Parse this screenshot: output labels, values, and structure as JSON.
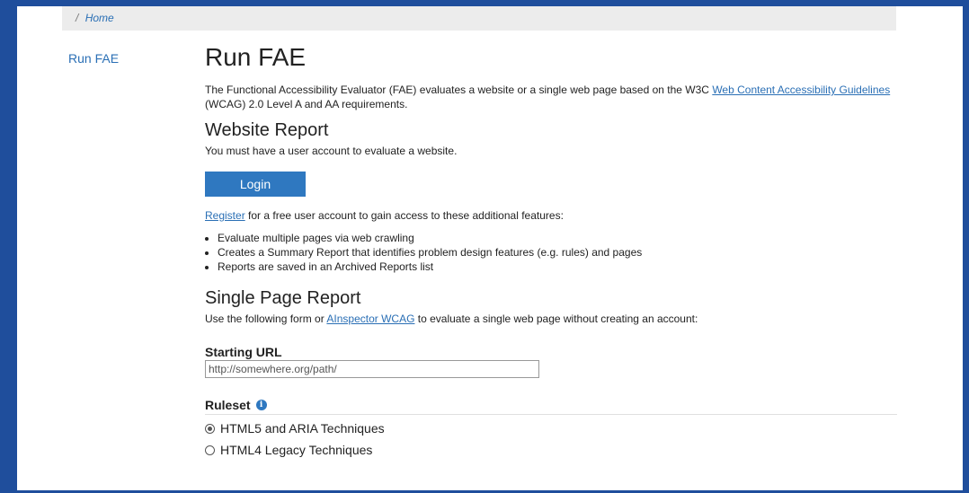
{
  "breadcrumb": {
    "separator": "/",
    "home": "Home"
  },
  "sidenav": {
    "item": "Run FAE"
  },
  "page": {
    "title": "Run FAE",
    "intro_before": "The Functional Accessibility Evaluator (FAE) evaluates a website or a single web page based on the W3C ",
    "intro_link": "Web Content Accessibility Guidelines",
    "intro_after": " (WCAG) 2.0 Level A and AA requirements."
  },
  "website_report": {
    "heading": "Website Report",
    "note": "You must have a user account to evaluate a website.",
    "login_label": "Login",
    "register_link": "Register",
    "register_text": " for a free user account to gain access to these additional features:",
    "features": [
      "Evaluate multiple pages via web crawling",
      "Creates a Summary Report that identifies problem design features (e.g. rules) and pages",
      "Reports are saved in an Archived Reports list"
    ]
  },
  "single_page": {
    "heading": "Single Page Report",
    "text_before": "Use the following form or ",
    "link": "AInspector WCAG",
    "text_after": " to evaluate a single web page without creating an account:",
    "url_label": "Starting URL",
    "url_placeholder": "http://somewhere.org/path/",
    "ruleset_label": "Ruleset",
    "info_glyph": "i",
    "options": [
      {
        "label": "HTML5 and ARIA Techniques",
        "checked": true
      },
      {
        "label": "HTML4 Legacy Techniques",
        "checked": false
      }
    ]
  },
  "colors": {
    "frame": "#1f4e9c",
    "accent": "#2f78c0",
    "link": "#2a6fb5"
  }
}
